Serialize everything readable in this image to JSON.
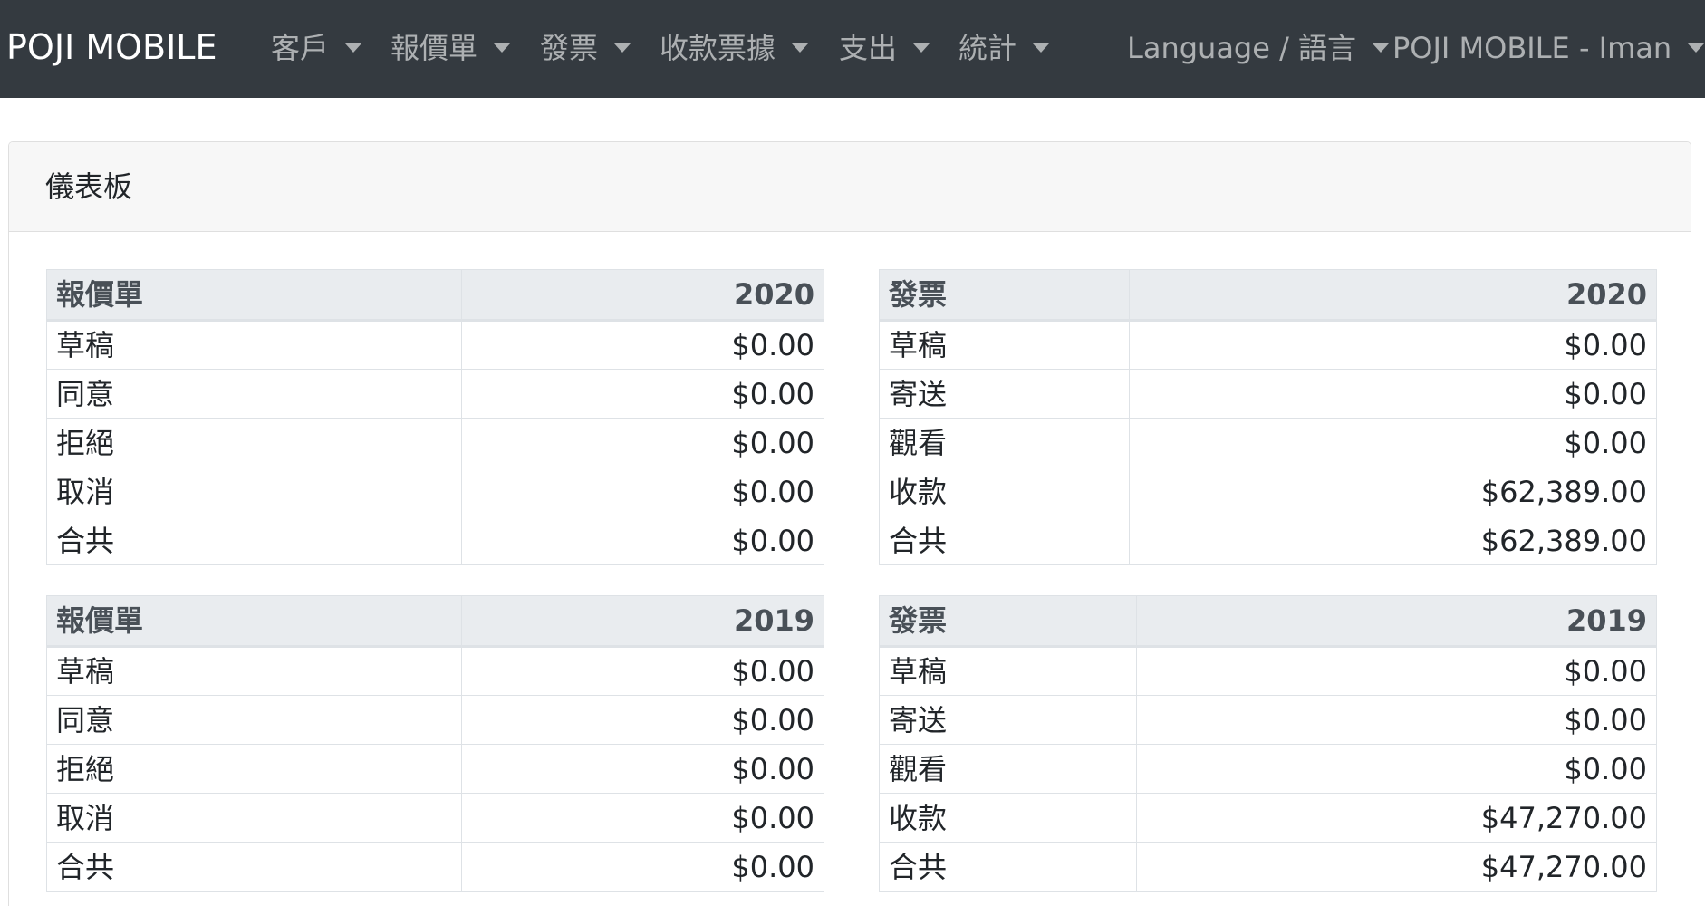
{
  "navbar": {
    "brand": "POJI MOBILE",
    "items": [
      {
        "label": "客戶"
      },
      {
        "label": "報價單"
      },
      {
        "label": "發票"
      },
      {
        "label": "收款票據"
      },
      {
        "label": "支出"
      },
      {
        "label": "統計"
      }
    ],
    "language": "Language / 語言",
    "user": "POJI MOBILE - Iman"
  },
  "card": {
    "title": "儀表板"
  },
  "tables": {
    "quotes_2020": {
      "header_label": "報價單",
      "year": "2020",
      "rows": [
        {
          "label": "草稿",
          "value": "$0.00"
        },
        {
          "label": "同意",
          "value": "$0.00"
        },
        {
          "label": "拒絕",
          "value": "$0.00"
        },
        {
          "label": "取消",
          "value": "$0.00"
        },
        {
          "label": "合共",
          "value": "$0.00"
        }
      ]
    },
    "invoices_2020": {
      "header_label": "發票",
      "year": "2020",
      "rows": [
        {
          "label": "草稿",
          "value": "$0.00"
        },
        {
          "label": "寄送",
          "value": "$0.00"
        },
        {
          "label": "觀看",
          "value": "$0.00"
        },
        {
          "label": "收款",
          "value": "$62,389.00"
        },
        {
          "label": "合共",
          "value": "$62,389.00"
        }
      ]
    },
    "quotes_2019": {
      "header_label": "報價單",
      "year": "2019",
      "rows": [
        {
          "label": "草稿",
          "value": "$0.00"
        },
        {
          "label": "同意",
          "value": "$0.00"
        },
        {
          "label": "拒絕",
          "value": "$0.00"
        },
        {
          "label": "取消",
          "value": "$0.00"
        },
        {
          "label": "合共",
          "value": "$0.00"
        }
      ]
    },
    "invoices_2019": {
      "header_label": "發票",
      "year": "2019",
      "rows": [
        {
          "label": "草稿",
          "value": "$0.00"
        },
        {
          "label": "寄送",
          "value": "$0.00"
        },
        {
          "label": "觀看",
          "value": "$0.00"
        },
        {
          "label": "收款",
          "value": "$47,270.00"
        },
        {
          "label": "合共",
          "value": "$47,270.00"
        }
      ]
    }
  }
}
